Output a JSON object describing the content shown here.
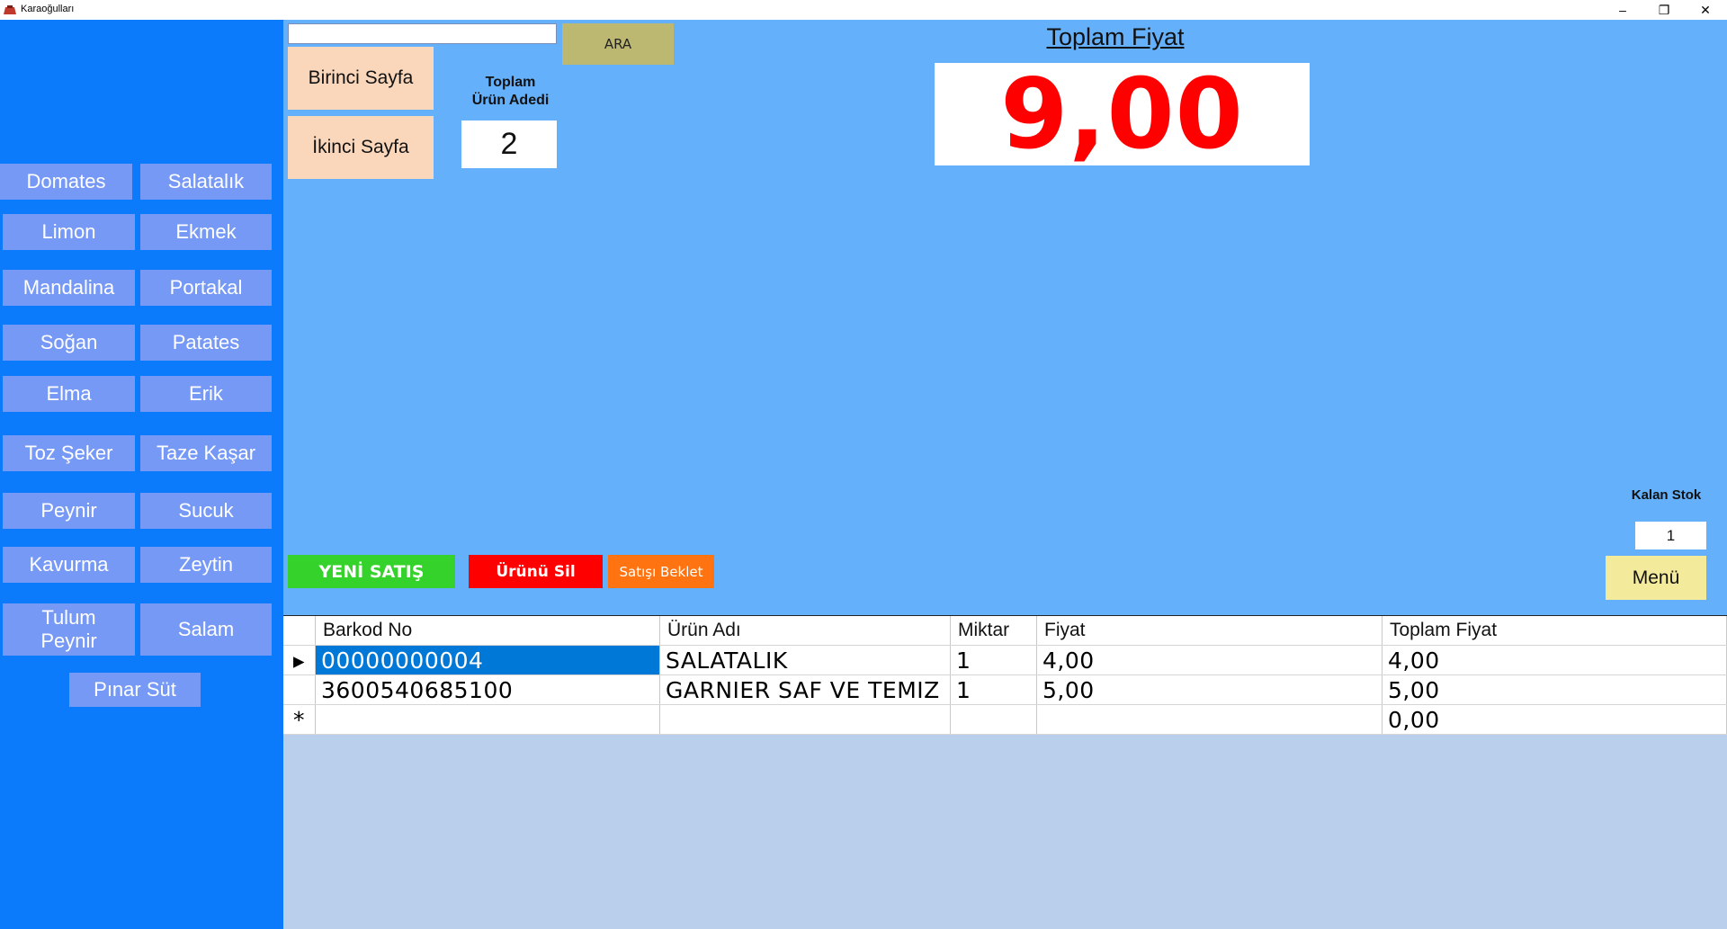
{
  "window": {
    "title": "Karaoğulları",
    "controls": {
      "minimize": "–",
      "restore": "❐",
      "close": "✕"
    }
  },
  "products": [
    "Domates",
    "Salatalık",
    "Limon",
    "Ekmek",
    "Mandalina",
    "Portakal",
    "Soğan",
    "Patates",
    "Elma",
    "Erik",
    "Toz Şeker",
    "Taze Kaşar",
    "Peynir",
    "Sucuk",
    "Kavurma",
    "Zeytin",
    "Tulum\nPeynir",
    "Salam",
    "Pınar Süt"
  ],
  "search": {
    "value": "",
    "button_label": "ARA"
  },
  "pages": {
    "first": "Birinci  Sayfa",
    "second": "İkinci Sayfa"
  },
  "total_count": {
    "label": "Toplam\nÜrün Adedi",
    "value": "2"
  },
  "total_price": {
    "title": "Toplam Fiyat",
    "value": "9,00"
  },
  "actions": {
    "new_sale": "YENİ SATIŞ",
    "delete_item": "Ürünü Sil",
    "hold_sale": "Satışı Beklet"
  },
  "stock": {
    "label": "Kalan Stok",
    "value": "1"
  },
  "menu_label": "Menü",
  "grid": {
    "columns": [
      "Barkod No",
      "Ürün Adı",
      "Miktar",
      "Fiyat",
      "Toplam Fiyat"
    ],
    "rows": [
      {
        "indicator": "▸",
        "cells": [
          "00000000004",
          "SALATALIK",
          "1",
          "4,00",
          "4,00"
        ]
      },
      {
        "indicator": "",
        "cells": [
          "3600540685100",
          "GARNIER SAF VE TEMIZ",
          "1",
          "5,00",
          "5,00"
        ]
      },
      {
        "indicator": "*",
        "cells": [
          "",
          "",
          "",
          "",
          "0,00"
        ]
      }
    ]
  },
  "colors": {
    "background": "#64b0fb",
    "left_panel": "#0c7bfb",
    "product_button": "#7799f6",
    "new_sale": "#35d22b",
    "delete_item": "#ff0000",
    "hold_sale": "#ff7410",
    "price_text": "#ff0000"
  }
}
